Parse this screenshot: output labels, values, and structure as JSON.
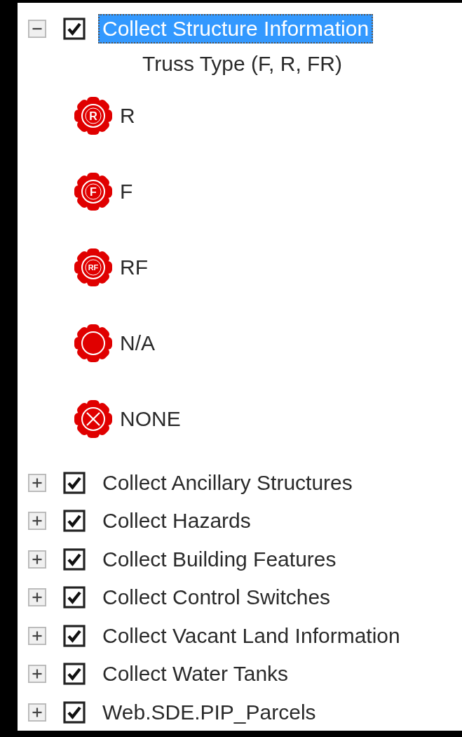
{
  "layers": [
    {
      "name": "Collect Structure Information",
      "expanded": true,
      "checked": true,
      "selected": true,
      "field": "Truss Type (F, R, FR)",
      "symbols": [
        {
          "label": "R",
          "kind": "lettered",
          "mark": "R"
        },
        {
          "label": "F",
          "kind": "lettered",
          "mark": "F"
        },
        {
          "label": "RF",
          "kind": "lettered",
          "mark": "RF"
        },
        {
          "label": "N/A",
          "kind": "solid"
        },
        {
          "label": "NONE",
          "kind": "cross"
        }
      ]
    },
    {
      "name": "Collect Ancillary Structures",
      "expanded": false,
      "checked": true,
      "selected": false
    },
    {
      "name": "Collect Hazards",
      "expanded": false,
      "checked": true,
      "selected": false
    },
    {
      "name": "Collect Building Features",
      "expanded": false,
      "checked": true,
      "selected": false
    },
    {
      "name": "Collect Control Switches",
      "expanded": false,
      "checked": true,
      "selected": false
    },
    {
      "name": "Collect Vacant Land Information",
      "expanded": false,
      "checked": true,
      "selected": false
    },
    {
      "name": "Collect Water Tanks",
      "expanded": false,
      "checked": true,
      "selected": false
    },
    {
      "name": "Web.SDE.PIP_Parcels",
      "expanded": false,
      "checked": true,
      "selected": false
    }
  ]
}
